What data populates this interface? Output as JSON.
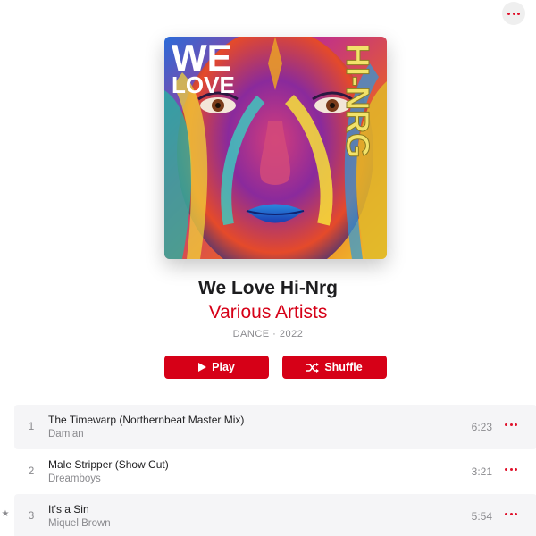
{
  "header": {
    "more_icon": "ellipsis-icon"
  },
  "album": {
    "artwork": {
      "alt": "album-cover",
      "text_left_1": "WE",
      "text_left_2": "LOVE",
      "text_right": "HI-NRG"
    },
    "title": "We Love Hi-Nrg",
    "artist": "Various Artists",
    "meta": "DANCE · 2022"
  },
  "actions": {
    "play_label": "Play",
    "shuffle_label": "Shuffle",
    "accent_color": "#d60017"
  },
  "tracks": [
    {
      "num": "1",
      "title": "The Timewarp (Northernbeat Master Mix)",
      "artist": "Damian",
      "duration": "6:23",
      "star": ""
    },
    {
      "num": "2",
      "title": "Male Stripper (Show Cut)",
      "artist": "Dreamboys",
      "duration": "3:21",
      "star": ""
    },
    {
      "num": "3",
      "title": "It's a Sin",
      "artist": "Miquel Brown",
      "duration": "5:54",
      "star": "★"
    }
  ]
}
